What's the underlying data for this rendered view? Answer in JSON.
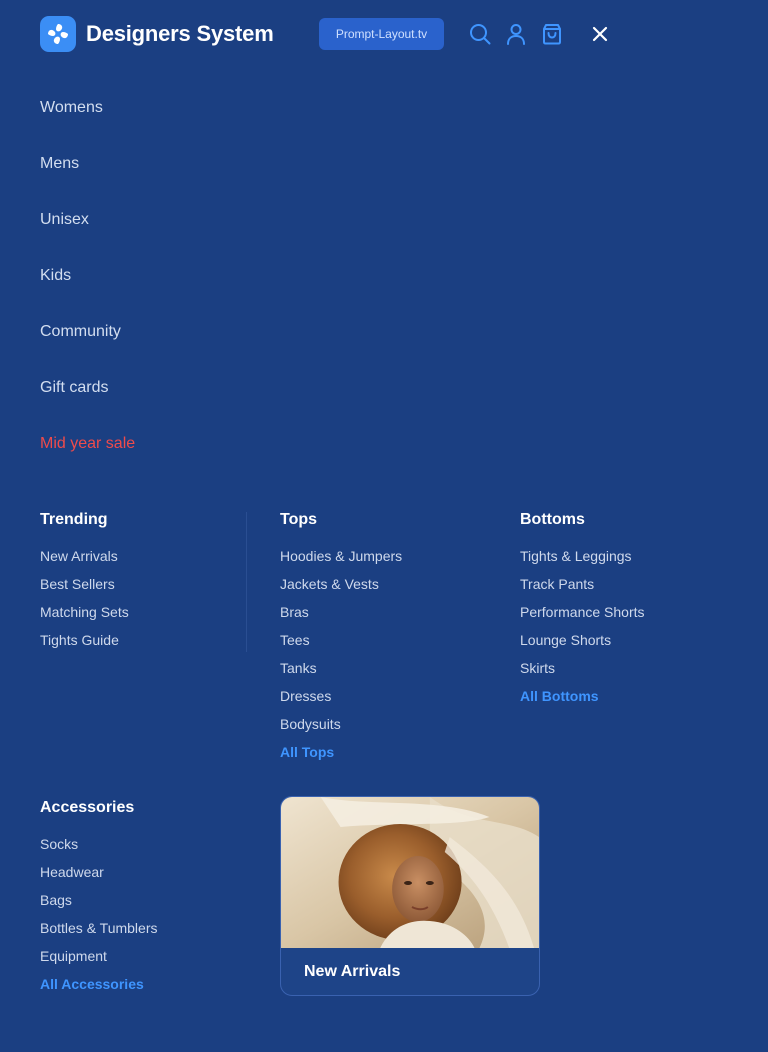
{
  "header": {
    "brand": "Designers System",
    "promo_label": "Prompt-Layout.tv",
    "icons": [
      "search-icon",
      "user-icon",
      "bag-icon",
      "close-icon"
    ]
  },
  "main_nav": [
    "Womens",
    "Mens",
    "Unisex",
    "Kids",
    "Community",
    "Gift cards",
    "Mid year sale"
  ],
  "columns": {
    "trending": {
      "title": "Trending",
      "items": [
        "New Arrivals",
        "Best Sellers",
        "Matching Sets",
        "Tights Guide"
      ]
    },
    "tops": {
      "title": "Tops",
      "items": [
        "Hoodies & Jumpers",
        "Jackets & Vests",
        "Bras",
        "Tees",
        "Tanks",
        "Dresses",
        "Bodysuits"
      ],
      "all_label": "All Tops"
    },
    "bottoms": {
      "title": "Bottoms",
      "items": [
        "Tights & Leggings",
        "Track Pants",
        "Performance Shorts",
        "Lounge Shorts",
        "Skirts"
      ],
      "all_label": "All Bottoms"
    },
    "accessories": {
      "title": "Accessories",
      "items": [
        "Socks",
        "Headwear",
        "Bags",
        "Bottles & Tumblers",
        "Equipment"
      ],
      "all_label": "All Accessories"
    }
  },
  "feature_card": {
    "label": "New Arrivals"
  },
  "colors": {
    "background": "#1b3f82",
    "accent": "#3f95ff",
    "sale": "#ef4b4b"
  }
}
